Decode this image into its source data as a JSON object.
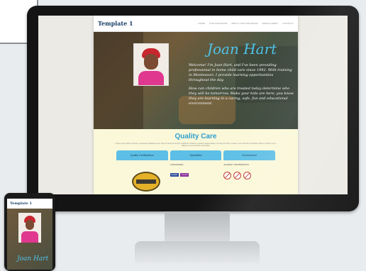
{
  "desktop_site": {
    "logo": "Template 1",
    "nav": [
      "HOME",
      "OUR PROGRAM",
      "ABOUT OUR PROGRAM",
      "ENROLLMENT",
      "CONTACT"
    ],
    "hero": {
      "name": "Joan Hart",
      "paragraph1": "Welcome! I'm Joan Hart, and I've been providing professional in home child care since 1992. With training in Montessori, I provide learning opportunities throughout the day.",
      "paragraph2": "How can children who are treated today determine who they will be tomorrow. Make your kids are here, you know they are learning in a caring, safe, fun and educational environment."
    },
    "quality": {
      "title": "Quality Care",
      "text": "Lorem ipsum dolor sit amet, consectetur adipiscing elit. Sed do eiusmod tempor incididunt ut labore et dolore magna aliqua. Ut enim ad minim veniam, quis nostrud exercitation ullamco laboris nisi ut aliquip ex ea commodo consequat.",
      "tabs": [
        "Quality Certifications",
        "Specialties",
        "Environment"
      ],
      "languages_label": "LANGUAGES",
      "languages": [
        "English",
        "French"
      ],
      "allergy_label": "ALLERGY INFORMATION"
    }
  },
  "mobile_site": {
    "logo": "Template 1",
    "name": "Joan Hart"
  },
  "colors": {
    "accent": "#4fc3ea",
    "tab_blue": "#5dbfe6",
    "cream": "#fbf8d9",
    "logo_navy": "#1a3f66"
  }
}
